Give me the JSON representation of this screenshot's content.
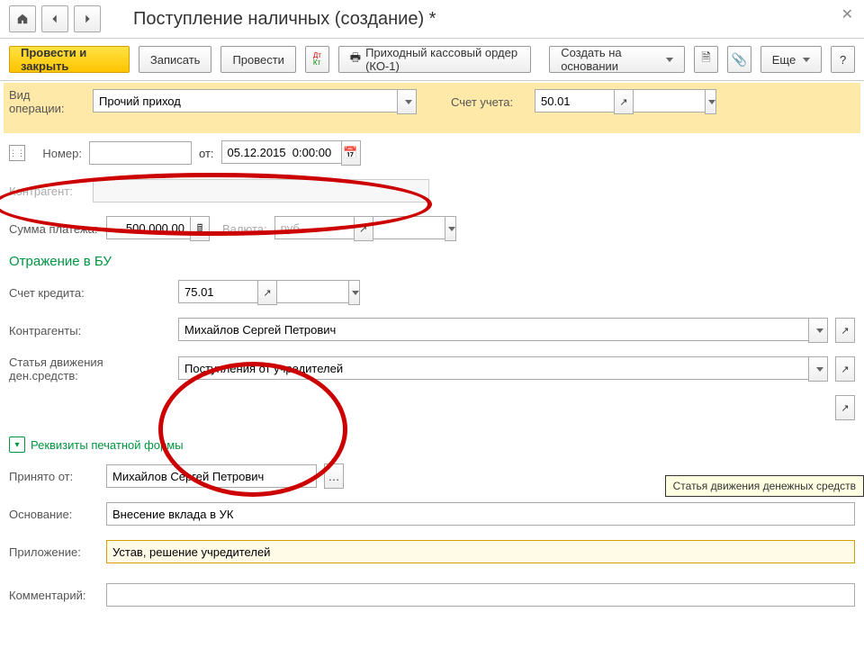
{
  "header": {
    "title": "Поступление наличных (создание) *"
  },
  "toolbar": {
    "post_close": "Провести и закрыть",
    "write": "Записать",
    "post": "Провести",
    "order": "Приходный кассовый ордер (КО-1)",
    "create_based": "Создать на основании",
    "more": "Еще",
    "help": "?"
  },
  "fields": {
    "op_type_label": "Вид операции:",
    "op_type_value": "Прочий приход",
    "account_label": "Счет учета:",
    "account_value": "50.01",
    "number_label": "Номер:",
    "number_value": "",
    "from_label": "от:",
    "date_value": "05.12.2015  0:00:00",
    "counterparty_label": "Контрагент:",
    "counterparty_value": "",
    "sum_label": "Сумма платежа:",
    "sum_value": "500 000,00",
    "currency_label": "Валюта:",
    "currency_value": "руб."
  },
  "bu": {
    "title": "Отражение в БУ",
    "credit_label": "Счет кредита:",
    "credit_value": "75.01",
    "counterparties_label": "Контрагенты:",
    "counterparties_value": "Михайлов Сергей Петрович",
    "cashflow_label": "Статья движения ден.средств:",
    "cashflow_value": "Поступления от учредителей"
  },
  "print": {
    "toggle": "Реквизиты печатной формы",
    "received_from_label": "Принято от:",
    "received_from_value": "Михайлов Сергей Петрович",
    "basis_label": "Основание:",
    "basis_value": "Внесение вклада в УК",
    "attachment_label": "Приложение:",
    "attachment_value": "Устав, решение учредителей",
    "comment_label": "Комментарий:"
  },
  "tooltip": "Статья движения денежных средств"
}
